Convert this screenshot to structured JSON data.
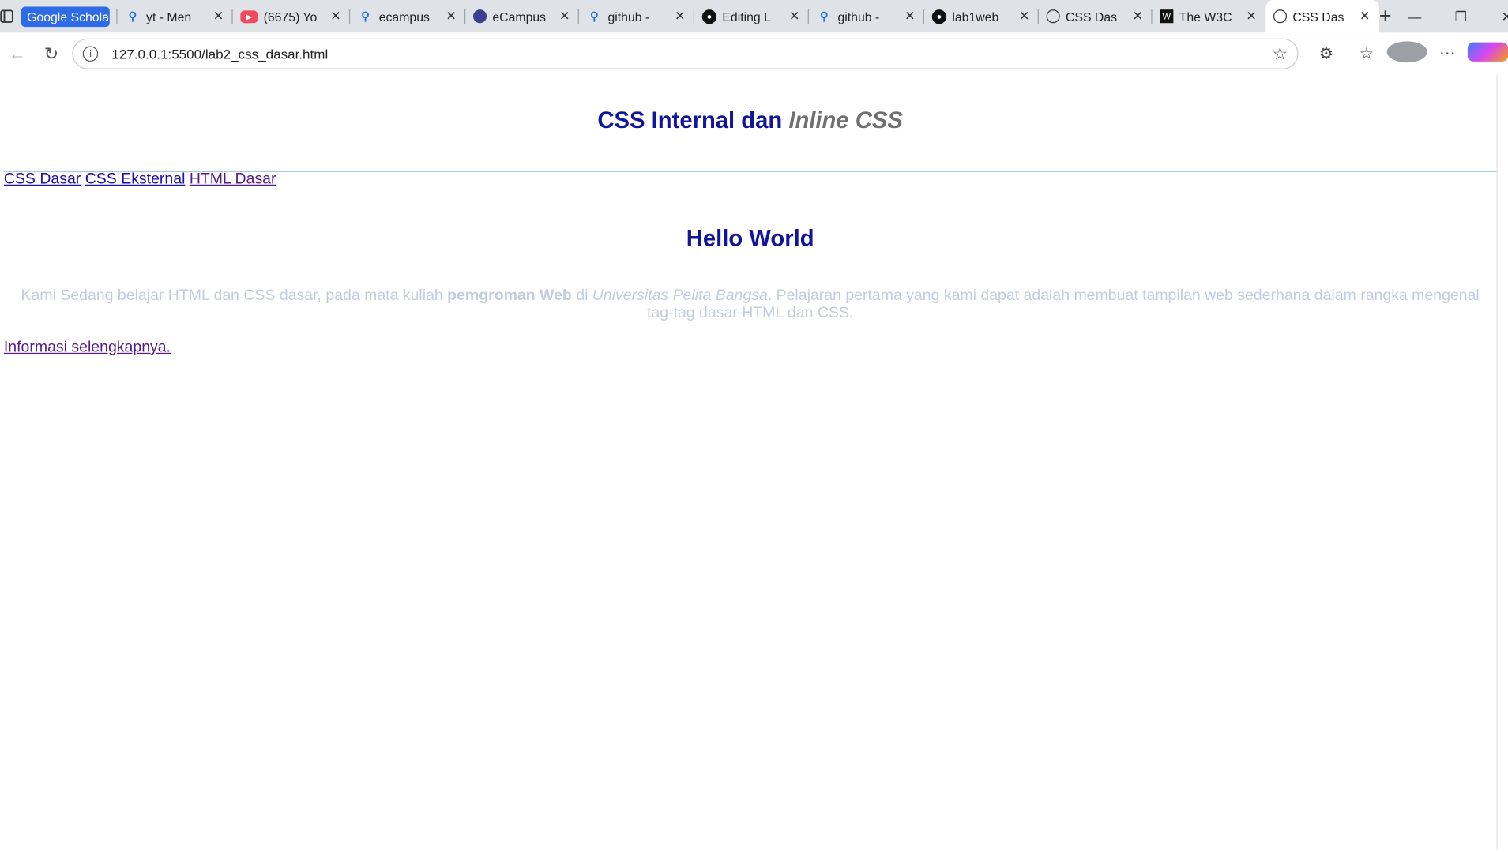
{
  "browser": {
    "tabs": [
      {
        "title": "Google Scholar",
        "icon": "google-scholar-pill",
        "pill": true
      },
      {
        "title": "yt - Men",
        "icon": "search-icon"
      },
      {
        "title": "(6675) Yo",
        "icon": "youtube-icon"
      },
      {
        "title": "ecampus",
        "icon": "search-icon"
      },
      {
        "title": "eCampus",
        "icon": "ecampus-icon"
      },
      {
        "title": "github -",
        "icon": "search-icon"
      },
      {
        "title": "Editing L",
        "icon": "github-icon"
      },
      {
        "title": "github -",
        "icon": "search-icon"
      },
      {
        "title": "lab1web",
        "icon": "github-icon"
      },
      {
        "title": "CSS Das",
        "icon": "globe-icon"
      },
      {
        "title": "The W3C",
        "icon": "w3c-icon"
      },
      {
        "title": "CSS Das",
        "icon": "globe-icon",
        "active": true
      }
    ],
    "url": "127.0.0.1:5500/lab2_css_dasar.html"
  },
  "page": {
    "h1_main": "CSS Internal dan ",
    "h1_italic": "Inline CSS",
    "nav": [
      "CSS Dasar",
      "CSS Eksternal",
      "HTML Dasar"
    ],
    "heading": "Hello World",
    "para": {
      "p1": "Kami Sedang belajar HTML dan CSS dasar, pada mata kuliah ",
      "bold": "pemgroman Web",
      "p2": " di ",
      "italic": "Universitas Pelita Bangsa",
      "p3": ". Pelajaran pertama yang kami dapat adalah membuat tampilan web sederhana dalam rangka mengenal tag-tag dasar HTML dan CSS."
    },
    "more_link": "Informasi selengkapnya."
  },
  "colors": {
    "heading": "#10159a",
    "italic_gray": "#707070",
    "para": "#c5ccdf",
    "link": "#1a0dab",
    "link_visited": "#551a8b",
    "hr": "#9fc9d7"
  }
}
